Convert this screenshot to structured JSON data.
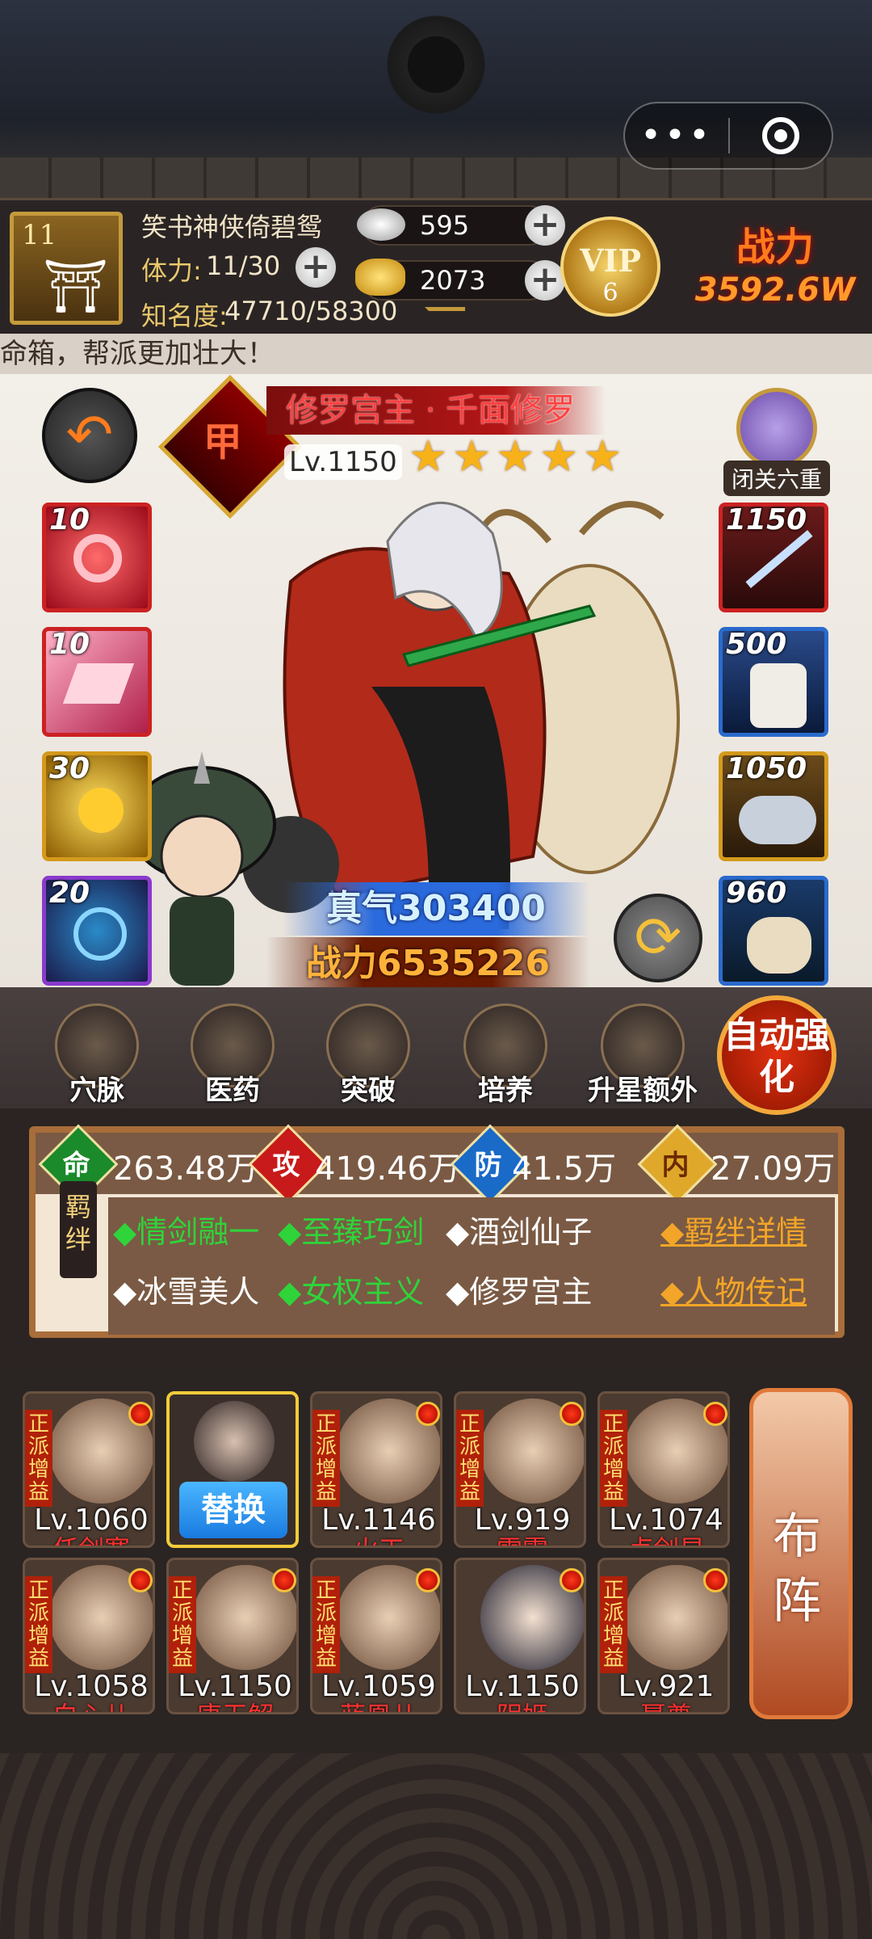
{
  "header": {
    "player_level": "11",
    "player_name": "笑书神侠倚碧鸳",
    "stamina_label": "体力:",
    "stamina_value": "11/30",
    "fame_label": "知名度:",
    "fame_value": "47710/58300",
    "silver": "595",
    "gold": "2073",
    "vip_text": "VIP",
    "vip_level": "6",
    "power_label": "战力",
    "power_value": "3592.6W"
  },
  "ticker": "命箱，帮派更加壮大！",
  "hero": {
    "quality": "橙甲",
    "name": "修罗宫主 · 千面修罗",
    "level": "Lv.1150",
    "stars": 5,
    "seclusion_label": "闭关六重",
    "qi_label": "真气",
    "qi_value": "303400",
    "power_label": "战力",
    "power_value": "6535226"
  },
  "skills_left": [
    {
      "level": "10",
      "icon": "heart-swirl-icon",
      "color": "#c8202a"
    },
    {
      "level": "10",
      "icon": "pink-crystal-icon",
      "color": "#c8202a"
    },
    {
      "level": "30",
      "icon": "golden-dragon-icon",
      "color": "#d49a1c"
    },
    {
      "level": "20",
      "icon": "blue-orb-icon",
      "color": "#8a3acc"
    }
  ],
  "equips_right": [
    {
      "level": "1150",
      "icon": "sword-icon",
      "color": "#c8202a"
    },
    {
      "level": "500",
      "icon": "robe-icon",
      "color": "#2a6acc"
    },
    {
      "level": "1050",
      "icon": "tiger-mount-icon",
      "color": "#d49a1c"
    },
    {
      "level": "960",
      "icon": "deer-mount-icon",
      "color": "#2a6acc"
    }
  ],
  "actions": [
    {
      "label": "穴脉",
      "icon": "meridian-icon"
    },
    {
      "label": "医药",
      "icon": "medicine-icon"
    },
    {
      "label": "突破",
      "icon": "breakthrough-icon"
    },
    {
      "label": "培养",
      "icon": "scroll-icon"
    },
    {
      "label": "升星额外",
      "icon": "upgrade-chest-icon"
    }
  ],
  "auto_strengthen": "自动强化",
  "attributes": {
    "life_label": "命",
    "life_value": "263.48万",
    "attack_label": "攻",
    "attack_value": "419.46万",
    "defense_label": "防",
    "defense_value": "41.5万",
    "inner_label": "内",
    "inner_value": "27.09万"
  },
  "bonds": {
    "tag": "羁绊",
    "row1": [
      "◆情剑融一",
      "◆至臻巧剑",
      "◆酒剑仙子"
    ],
    "row2": [
      "◆冰雪美人",
      "◆女权主义",
      "◆修罗宫主"
    ],
    "detail_link": "◆羁绊详情",
    "bio_link": "◆人物传记"
  },
  "team_row1": [
    {
      "tag": "正派增益",
      "level": "Lv.1060",
      "name": "任剑寒"
    },
    {
      "tag": "",
      "level": "",
      "name": ""
    },
    {
      "tag": "正派增益",
      "level": "Lv.1146",
      "name": "火工"
    },
    {
      "tag": "正派增益",
      "level": "Lv.919",
      "name": "雷震"
    },
    {
      "tag": "正派增益",
      "level": "Lv.1074",
      "name": "卢剑星"
    }
  ],
  "replace_label": "替换",
  "team_row2": [
    {
      "tag": "正派增益",
      "level": "Lv.1058",
      "name": "白心儿"
    },
    {
      "tag": "正派增益",
      "level": "Lv.1150",
      "name": "唐无解"
    },
    {
      "tag": "正派增益",
      "level": "Lv.1059",
      "name": "蓝凰儿"
    },
    {
      "tag": "",
      "level": "Lv.1150",
      "name": "阴姬"
    },
    {
      "tag": "正派增益",
      "level": "Lv.921",
      "name": "聂尊"
    }
  ],
  "buzhen": [
    "布",
    "阵"
  ],
  "capsule": {
    "more": "•••"
  }
}
